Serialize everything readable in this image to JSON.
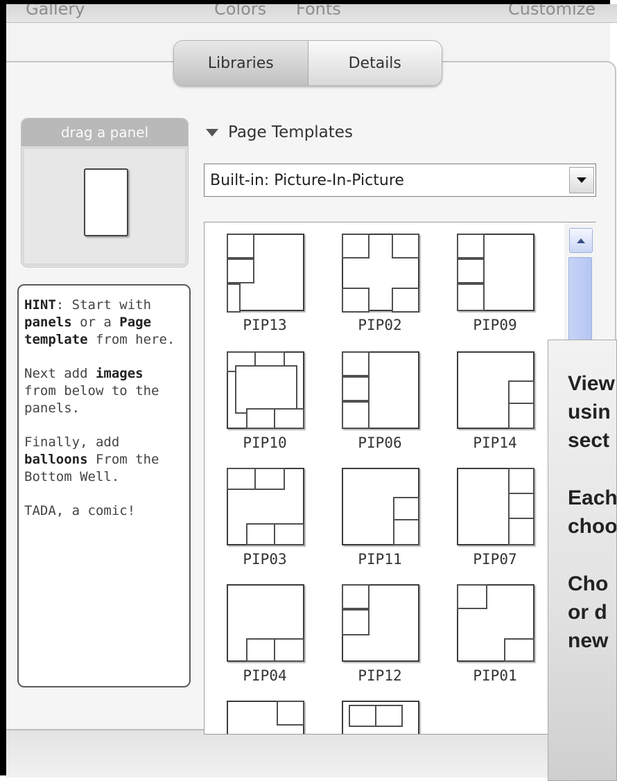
{
  "top_tabs": [
    "Gallery",
    "Colors",
    "Fonts",
    "Customize"
  ],
  "tabs": [
    {
      "label": "Libraries",
      "active": true
    },
    {
      "label": "Details",
      "active": false
    }
  ],
  "drag_panel": {
    "title": "drag a panel"
  },
  "hint": {
    "p1": {
      "a": "HINT",
      "b": ": Start with ",
      "c": "panels",
      "d": " or a ",
      "e": "Page template",
      "f": " from here."
    },
    "p2": {
      "a": "Next add ",
      "b": "images",
      "c": " from below to the panels."
    },
    "p3": {
      "a": "Finally, add ",
      "b": "balloons",
      "c": " From the Bottom Well."
    },
    "p4": "TADA, a comic!"
  },
  "page_templates": {
    "heading": "Page Templates",
    "selected": "Built-in: Picture-In-Picture",
    "items": [
      "PIP13",
      "PIP02",
      "PIP09",
      "PIP10",
      "PIP06",
      "PIP14",
      "PIP03",
      "PIP11",
      "PIP07",
      "PIP04",
      "PIP12",
      "PIP01",
      "",
      ""
    ]
  },
  "callout": {
    "lines_a": [
      "View",
      "usin",
      "sect"
    ],
    "lines_b": [
      "Each",
      "choo"
    ],
    "lines_c": [
      "Cho",
      "or d",
      "new"
    ]
  },
  "colors": {
    "accent_scroll": "#b5c6f1",
    "frame": "#000000"
  }
}
